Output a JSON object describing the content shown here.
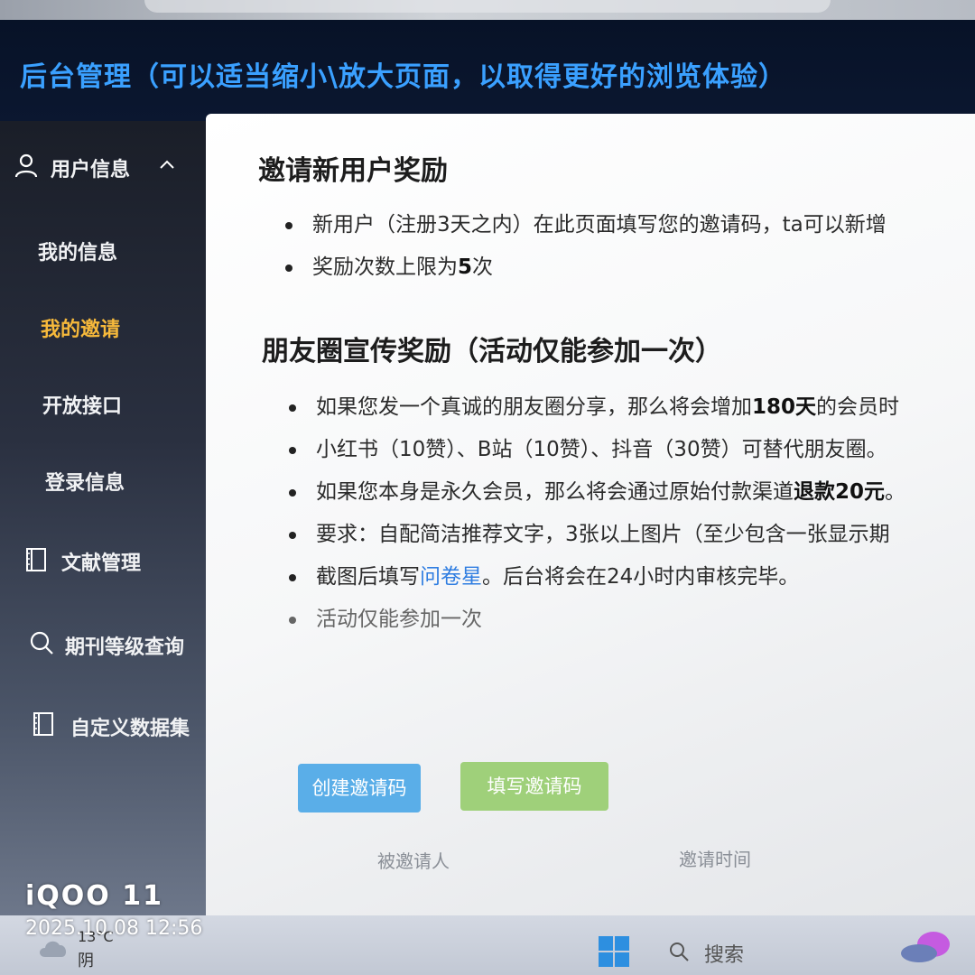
{
  "header": {
    "title": "后台管理（可以适当缩小\\放大页面，以取得更好的浏览体验）"
  },
  "sidebar": {
    "items": [
      {
        "label": "用户信息",
        "icon": "user-icon",
        "expanded": true
      },
      {
        "label": "我的信息"
      },
      {
        "label": "我的邀请",
        "active": true
      },
      {
        "label": "开放接口"
      },
      {
        "label": "登录信息"
      },
      {
        "label": "文献管理",
        "icon": "book-icon"
      },
      {
        "label": "期刊等级查询",
        "icon": "search-icon"
      },
      {
        "label": "自定义数据集",
        "icon": "book-icon"
      }
    ],
    "active_color": "#f6b93b"
  },
  "invite_section": {
    "title": "邀请新用户奖励",
    "items": [
      "新用户（注册3天之内）在此页面填写您的邀请码，ta可以新增",
      {
        "before": "奖励次数上限为",
        "bold": "5",
        "after": "次"
      }
    ]
  },
  "moments_section": {
    "title": "朋友圈宣传奖励（活动仅能参加一次）",
    "items": [
      {
        "before": "如果您发一个真诚的朋友圈分享，那么将会增加",
        "bold": "180天",
        "after": "的会员时"
      },
      "小红书（10赞）、B站（10赞）、抖音（30赞）可替代朋友圈。",
      {
        "before": "如果您本身是永久会员，那么将会通过原始付款渠道",
        "bold": "退款20元",
        "after": "。"
      },
      "要求：自配简洁推荐文字，3张以上图片（至少包含一张显示期",
      {
        "before": "截图后填写",
        "link": "问卷星",
        "after": "。后台将会在24小时内审核完毕。"
      },
      "活动仅能参加一次"
    ]
  },
  "buttons": {
    "create": "创建邀请码",
    "fill": "填写邀请码"
  },
  "table": {
    "headers": [
      "被邀请人",
      "邀请时间"
    ]
  },
  "taskbar": {
    "temperature": "13°C",
    "weather": "阴",
    "search": "搜索"
  },
  "watermark": {
    "brand": "iQOO 11",
    "timestamp": "2025.10.08 12:56"
  },
  "colors": {
    "header_title": "#3aa0ff",
    "link": "#2f7de1",
    "button_blue": "#5aaee8",
    "button_green": "#9fd07a"
  }
}
